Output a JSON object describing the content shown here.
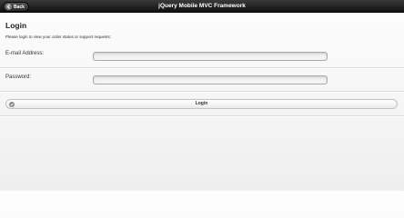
{
  "header": {
    "title": "jQuery Mobile MVC Framework",
    "back_label": "Back",
    "back_icon": "arrow-left-icon"
  },
  "page": {
    "title": "Login",
    "intro": "Please login to view your order status or support requests:"
  },
  "form": {
    "email_label": "E-mail Address:",
    "email_value": "",
    "password_label": "Password:",
    "password_value": ""
  },
  "login_button": {
    "label": "Login",
    "icon": "circle-check-icon"
  }
}
